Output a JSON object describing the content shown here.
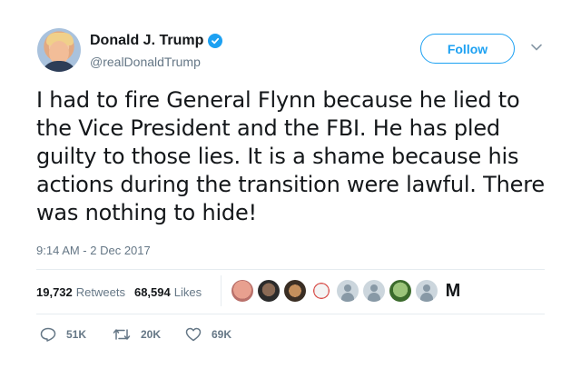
{
  "author": {
    "display_name": "Donald J. Trump",
    "handle": "@realDonaldTrump"
  },
  "header": {
    "follow_label": "Follow",
    "menu_icon": "chevron-down-icon"
  },
  "tweet": {
    "text": "I had to fire General Flynn because he lied to the Vice President and the FBI. He has pled guilty to those lies. It is a shame because his actions during the transition were lawful. There was nothing to hide!",
    "timestamp": "9:14 AM - 2 Dec 2017"
  },
  "stats": {
    "retweets_count": "19,732",
    "retweets_label": "Retweets",
    "likes_count": "68,594",
    "likes_label": "Likes"
  },
  "liked_by_letter": "M",
  "actions": {
    "reply_count": "51K",
    "retweet_count": "20K",
    "like_count": "69K"
  },
  "colors": {
    "accent": "#1da1f2",
    "secondary_text": "#657786",
    "primary_text": "#14171a",
    "divider": "#e6ecf0"
  }
}
